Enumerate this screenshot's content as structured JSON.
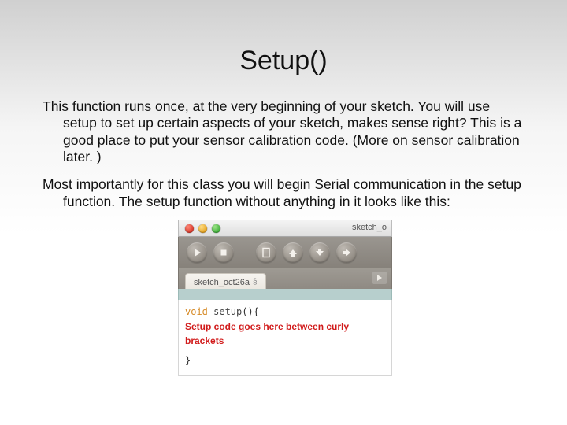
{
  "title": "Setup()",
  "para1": "This function runs once, at the very beginning of your sketch. You will use setup to set up certain aspects of your sketch, makes sense right? This is a good place to put your sensor calibration code. (More on sensor calibration later. )",
  "para2": "Most importantly for this class you will begin Serial communication in the setup function. The setup function without anything in it looks like this:",
  "ide": {
    "window_title": "sketch_o",
    "tab_label": "sketch_oct26a",
    "tab_section": "§",
    "code": {
      "kw_void": "void",
      "fn_name": " setup",
      "sig_rest": "(){",
      "comment": "Setup code goes here between curly brackets",
      "close": "}"
    }
  }
}
